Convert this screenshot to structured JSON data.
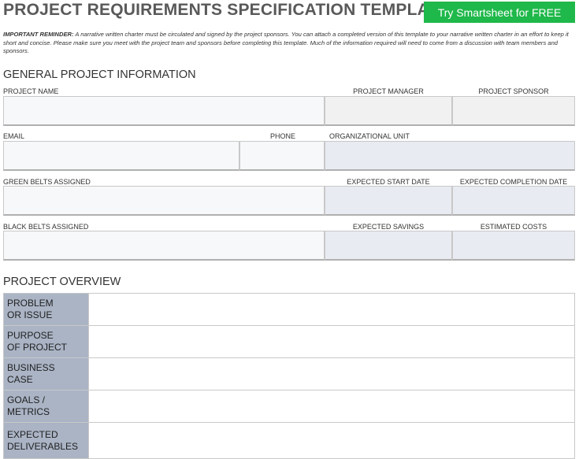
{
  "header": {
    "title": "PROJECT REQUIREMENTS SPECIFICATION TEMPLATE",
    "cta_label": "Try Smartsheet for FREE"
  },
  "reminder": {
    "lead": "IMPORTANT REMINDER:",
    "text": " A narrative written charter must be circulated and signed by the project sponsors. You can attach a completed version of this template to your narrative written charter in an effort to keep it short and concise. Please make sure you meet with the project team and sponsors before completing this template. Much of the information required will need to come from a discussion with team members and sponsors."
  },
  "general": {
    "title": "GENERAL PROJECT INFORMATION",
    "project_name": "PROJECT NAME",
    "project_manager": "PROJECT MANAGER",
    "project_sponsor": "PROJECT SPONSOR",
    "email": "EMAIL",
    "phone": "PHONE",
    "org_unit": "ORGANIZATIONAL UNIT",
    "green_belts": "GREEN BELTS ASSIGNED",
    "start_date": "EXPECTED START DATE",
    "completion_date": "EXPECTED COMPLETION DATE",
    "black_belts": "BLACK BELTS ASSIGNED",
    "savings": "EXPECTED SAVINGS",
    "costs": "ESTIMATED COSTS"
  },
  "overview": {
    "title": "PROJECT OVERVIEW",
    "rows": [
      {
        "line1": "PROBLEM",
        "line2": "OR ISSUE"
      },
      {
        "line1": "PURPOSE",
        "line2": "OF PROJECT"
      },
      {
        "line1": "BUSINESS",
        "line2": "CASE"
      },
      {
        "line1": "GOALS /",
        "line2": "METRICS"
      },
      {
        "line1": "EXPECTED",
        "line2": "DELIVERABLES"
      }
    ]
  }
}
